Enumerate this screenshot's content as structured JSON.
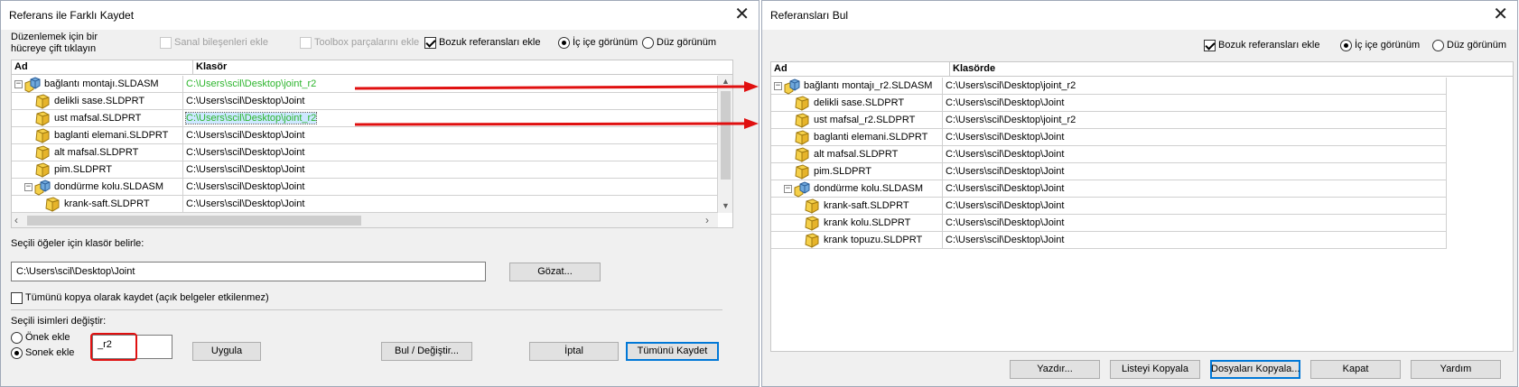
{
  "colors": {
    "accent": "#0078d7",
    "green_path": "#2db52d",
    "arrow": "#e01010",
    "highlight_box": "#e01010"
  },
  "dialog1": {
    "title": "Referans ile Farklı Kaydet",
    "hint_line1": "Düzenlemek için bir",
    "hint_line2": "hücreye çift tıklayın",
    "opt_virtual": "Sanal bileşenleri ekle",
    "opt_toolbox": "Toolbox parçalarını ekle",
    "opt_broken": "Bozuk referansları ekle",
    "view_nested": "İç içe görünüm",
    "view_flat": "Düz görünüm",
    "col_name": "Ad",
    "col_folder": "Klasör",
    "rows": [
      {
        "name": "bağlantı montajı.SLDASM",
        "path": "C:\\Users\\scil\\Desktop\\joint_r2",
        "icon": "assembly-icon"
      },
      {
        "name": "delikli sase.SLDPRT",
        "path": "C:\\Users\\scil\\Desktop\\Joint",
        "icon": "part-icon"
      },
      {
        "name": "ust mafsal.SLDPRT",
        "path": "C:\\Users\\scil\\Desktop\\joint_r2",
        "icon": "part-icon"
      },
      {
        "name": "baglanti elemani.SLDPRT",
        "path": "C:\\Users\\scil\\Desktop\\Joint",
        "icon": "part-icon"
      },
      {
        "name": "alt mafsal.SLDPRT",
        "path": "C:\\Users\\scil\\Desktop\\Joint",
        "icon": "part-icon"
      },
      {
        "name": "pim.SLDPRT",
        "path": "C:\\Users\\scil\\Desktop\\Joint",
        "icon": "part-icon"
      },
      {
        "name": "dondürme kolu.SLDASM",
        "path": "C:\\Users\\scil\\Desktop\\Joint",
        "icon": "assembly-icon"
      },
      {
        "name": "krank-saft.SLDPRT",
        "path": "C:\\Users\\scil\\Desktop\\Joint",
        "icon": "part-icon"
      }
    ],
    "folder_label": "Seçili öğeler için klasör belirle:",
    "folder_value": "C:\\Users\\scil\\Desktop\\Joint",
    "browse_btn": "Gözat...",
    "copy_all_label": "Tümünü kopya olarak kaydet (açık belgeler etkilenmez)",
    "rename_label": "Seçili isimleri değiştir:",
    "prefix_label": "Önek ekle",
    "suffix_label": "Sonek ekle",
    "suffix_value": "_r2",
    "apply_btn": "Uygula",
    "find_replace_btn": "Bul / Değiştir...",
    "cancel_btn": "İptal",
    "save_all_btn": "Tümünü Kaydet"
  },
  "dialog2": {
    "title": "Referansları Bul",
    "opt_broken": "Bozuk referansları ekle",
    "view_nested": "İç içe görünüm",
    "view_flat": "Düz görünüm",
    "col_name": "Ad",
    "col_folder": "Klasörde",
    "rows": [
      {
        "name": "bağlantı montajı_r2.SLDASM",
        "path": "C:\\Users\\scil\\Desktop\\joint_r2",
        "icon": "assembly-icon"
      },
      {
        "name": "delikli sase.SLDPRT",
        "path": "C:\\Users\\scil\\Desktop\\Joint",
        "icon": "part-icon"
      },
      {
        "name": "ust mafsal_r2.SLDPRT",
        "path": "C:\\Users\\scil\\Desktop\\joint_r2",
        "icon": "part-icon"
      },
      {
        "name": "baglanti elemani.SLDPRT",
        "path": "C:\\Users\\scil\\Desktop\\Joint",
        "icon": "part-icon"
      },
      {
        "name": "alt mafsal.SLDPRT",
        "path": "C:\\Users\\scil\\Desktop\\Joint",
        "icon": "part-icon"
      },
      {
        "name": "pim.SLDPRT",
        "path": "C:\\Users\\scil\\Desktop\\Joint",
        "icon": "part-icon"
      },
      {
        "name": "dondürme kolu.SLDASM",
        "path": "C:\\Users\\scil\\Desktop\\Joint",
        "icon": "assembly-icon"
      },
      {
        "name": "krank-saft.SLDPRT",
        "path": "C:\\Users\\scil\\Desktop\\Joint",
        "icon": "part-icon"
      },
      {
        "name": "krank kolu.SLDPRT",
        "path": "C:\\Users\\scil\\Desktop\\Joint",
        "icon": "part-icon"
      },
      {
        "name": "krank topuzu.SLDPRT",
        "path": "C:\\Users\\scil\\Desktop\\Joint",
        "icon": "part-icon"
      }
    ],
    "print_btn": "Yazdır...",
    "copy_list_btn": "Listeyi Kopyala",
    "copy_files_btn": "Dosyaları Kopyala...",
    "close_btn": "Kapat",
    "help_btn": "Yardım"
  }
}
